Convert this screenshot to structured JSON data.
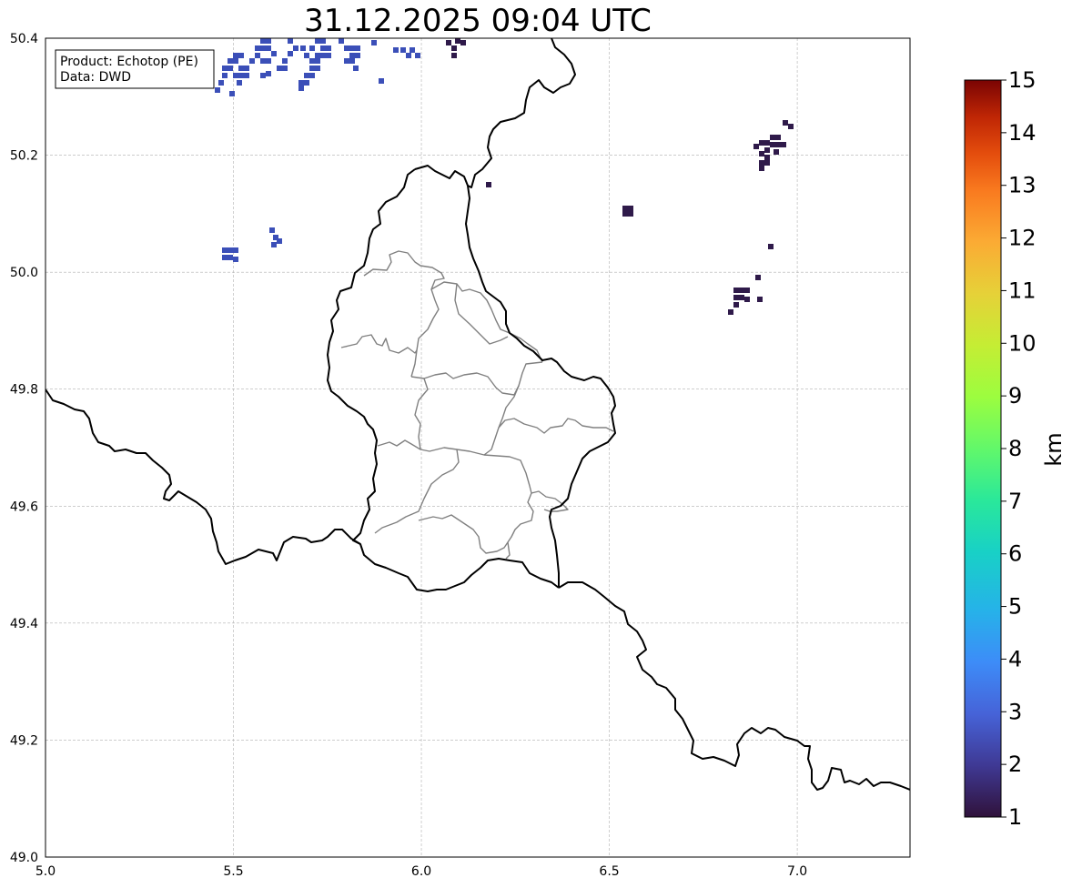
{
  "title": "31.12.2025 09:04 UTC",
  "info_box": {
    "product": "Product: Echotop (PE)",
    "data": "Data: DWD"
  },
  "map": {
    "x_ticks": [
      "5.0",
      "5.5",
      "6.0",
      "6.5",
      "7.0"
    ],
    "y_ticks": [
      "49.0",
      "49.2",
      "49.4",
      "49.6",
      "49.8",
      "50.0",
      "50.2",
      "50.4"
    ],
    "lon_range": [
      5.0,
      7.3
    ],
    "lat_range": [
      49.0,
      50.4
    ],
    "grid": true
  },
  "colorbar": {
    "label": "km",
    "ticks": [
      "1",
      "2",
      "3",
      "4",
      "5",
      "6",
      "7",
      "8",
      "9",
      "10",
      "11",
      "12",
      "13",
      "14",
      "15"
    ],
    "range": [
      1,
      15
    ],
    "colormap": "turbo"
  },
  "colors": {
    "low_echo": "#3b4fb8",
    "very_low_echo": "#2f1a4a",
    "border": "#000000",
    "district_border": "#808080",
    "grid": "#b0b0b0"
  }
}
